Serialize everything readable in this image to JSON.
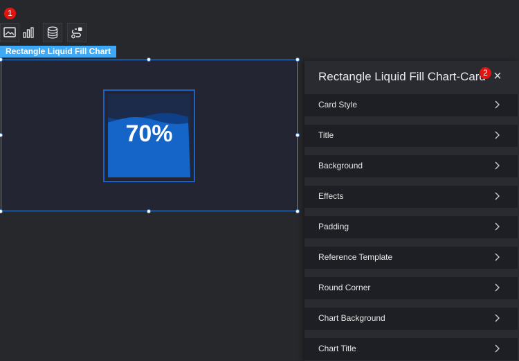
{
  "callouts": {
    "first": "1",
    "second": "2"
  },
  "toolbar": {
    "buttons": [
      {
        "icon": "image-icon"
      },
      {
        "icon": "bar-chart-icon"
      },
      {
        "icon": "database-icon"
      },
      {
        "icon": "data-link-icon"
      }
    ]
  },
  "widget": {
    "label": "Rectangle Liquid Fill Chart",
    "value": "70%",
    "fill_percent": 70,
    "colors": {
      "fill": "#1565c8",
      "wave_back": "#0f3f86",
      "frame": "#1a63c6",
      "accent": "#3fa9f5"
    }
  },
  "panel": {
    "title": "Rectangle Liquid Fill Chart-Card",
    "close": "×",
    "items": [
      {
        "label": "Card Style"
      },
      {
        "label": "Title"
      },
      {
        "label": "Background"
      },
      {
        "label": "Effects"
      },
      {
        "label": "Padding"
      },
      {
        "label": "Reference Template"
      },
      {
        "label": "Round Corner"
      },
      {
        "label": "Chart Background"
      },
      {
        "label": "Chart Title"
      }
    ]
  }
}
